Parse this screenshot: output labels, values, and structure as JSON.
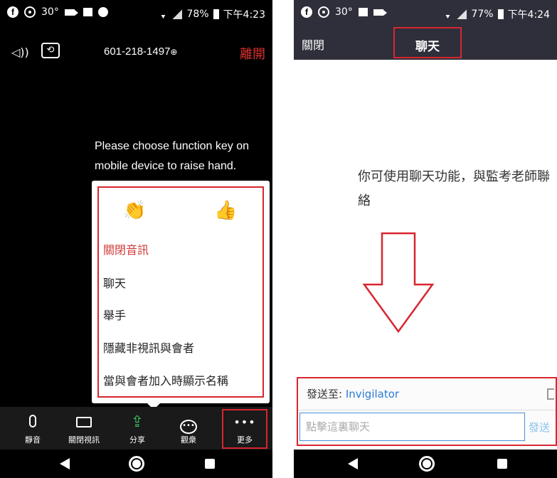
{
  "left_phone": {
    "status": {
      "temp": "30°",
      "battery": "78%",
      "time": "下午4:23"
    },
    "top_bar": {
      "meeting_id": "601-218-1497",
      "lock_glyph": "⊕",
      "leave": "離開"
    },
    "instruction": "Please choose function key on mobile device to raise hand.",
    "popup": {
      "reactions": [
        {
          "name": "clap",
          "glyph": "👏"
        },
        {
          "name": "thumbs-up",
          "glyph": "👍"
        }
      ],
      "items": [
        {
          "label": "關閉音訊",
          "style": "danger"
        },
        {
          "label": "聊天"
        },
        {
          "label": "舉手"
        },
        {
          "label": "隱藏非視訊與會者"
        },
        {
          "label": "當與會者加入時顯示名稱"
        }
      ]
    },
    "toolbar": [
      {
        "icon": "microphone-icon",
        "label": "靜音"
      },
      {
        "icon": "video-camera-icon",
        "label": "關閉視訊"
      },
      {
        "icon": "share-icon",
        "label": "分享",
        "color": "#3cc35a"
      },
      {
        "icon": "participants-icon",
        "label": "觀衆"
      },
      {
        "icon": "more-icon",
        "label": "更多",
        "glyph": "•••"
      }
    ],
    "highlight_color": "#d8262f"
  },
  "right_phone": {
    "status": {
      "temp": "30°",
      "battery": "77%",
      "time": "下午4:24"
    },
    "header": {
      "close": "關閉",
      "title": "聊天"
    },
    "hint": "你可使用聊天功能，與監考老師聯絡",
    "send_panel": {
      "send_to_label": "發送至: ",
      "send_to_name": "Invigilator",
      "input_placeholder": "點擊這裏聊天",
      "send_button": "發送"
    },
    "accent_color": "#2a7bd6"
  }
}
